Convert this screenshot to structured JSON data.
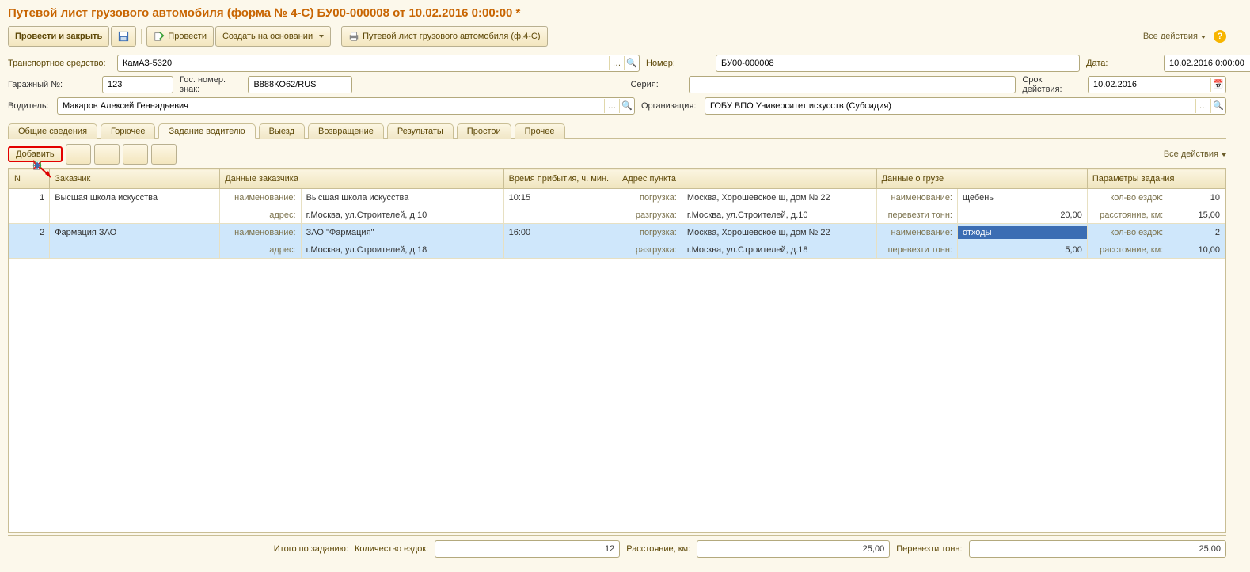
{
  "title": "Путевой лист грузового автомобиля (форма № 4-С) БУ00-000008 от 10.02.2016 0:00:00 *",
  "toolbar": {
    "post_and_close": "Провести и закрыть",
    "post": "Провести",
    "create_based": "Создать на основании",
    "print_doc": "Путевой лист грузового автомобиля (ф.4-С)",
    "all_actions": "Все действия"
  },
  "form": {
    "vehicle_lbl": "Транспортное средство:",
    "vehicle": "КамАЗ-5320",
    "number_lbl": "Номер:",
    "number": "БУ00-000008",
    "date_lbl": "Дата:",
    "date": "10.02.2016 0:00:00",
    "garage_lbl": "Гаражный №:",
    "garage": "123",
    "plate_lbl": "Гос. номер. знак:",
    "plate": "В888КО62/RUS",
    "series_lbl": "Серия:",
    "series": "",
    "validity_lbl": "Срок действия:",
    "validity": "10.02.2016",
    "driver_lbl": "Водитель:",
    "driver": "Макаров Алексей Геннадьевич",
    "org_lbl": "Организация:",
    "org": "ГОБУ ВПО Университет искусств (Субсидия)"
  },
  "tabs": {
    "t0": "Общие сведения",
    "t1": "Горючее",
    "t2": "Задание водителю",
    "t3": "Выезд",
    "t4": "Возвращение",
    "t5": "Результаты",
    "t6": "Простои",
    "t7": "Прочее"
  },
  "tab_toolbar": {
    "add": "Добавить",
    "all_actions": "Все действия"
  },
  "columns": {
    "n": "N",
    "customer": "Заказчик",
    "customer_data": "Данные заказчика",
    "arrival": "Время прибытия, ч. мин.",
    "address": "Адрес пункта",
    "cargo": "Данные о грузе",
    "params": "Параметры задания"
  },
  "sublabels": {
    "name": "наименование:",
    "addr": "адрес:",
    "load": "погрузка:",
    "unload": "разгрузка:",
    "cargo_name": "наименование:",
    "tons": "перевезти тонн:",
    "trips": "кол-во ездок:",
    "dist": "расстояние, км:"
  },
  "rows": [
    {
      "n": "1",
      "customer": "Высшая школа искусства",
      "name": "Высшая школа искусства",
      "addr": "г.Москва, ул.Строителей, д.10",
      "arrival": "10:15",
      "load": "Москва, Хорошевское ш, дом № 22",
      "unload": "г.Москва, ул.Строителей, д.10",
      "cargo_name": "щебень",
      "tons": "20,00",
      "trips": "10",
      "dist": "15,00"
    },
    {
      "n": "2",
      "customer": "Фармация ЗАО",
      "name": "ЗАО \"Фармация\"",
      "addr": "г.Москва, ул.Строителей, д.18",
      "arrival": "16:00",
      "load": "Москва, Хорошевское ш, дом № 22",
      "unload": "г.Москва, ул.Строителей, д.18",
      "cargo_name": "отходы",
      "tons": "5,00",
      "trips": "2",
      "dist": "10,00"
    }
  ],
  "totals": {
    "label": "Итого по заданию:",
    "trips_lbl": "Количество ездок:",
    "trips": "12",
    "dist_lbl": "Расстояние, км:",
    "dist": "25,00",
    "tons_lbl": "Перевезти тонн:",
    "tons": "25,00"
  }
}
